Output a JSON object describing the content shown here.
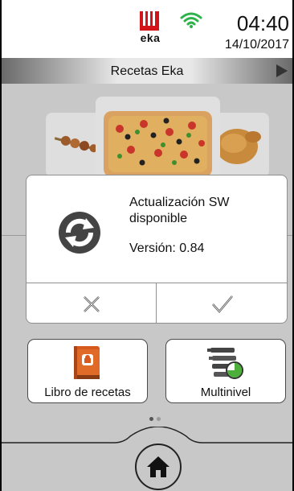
{
  "status": {
    "brand_logo_text": "eka",
    "time": "04:40",
    "date": "14/10/2017",
    "wifi_icon": "wifi-icon",
    "wifi_color": "#2db34a"
  },
  "titlebar": {
    "title": "Recetas Eka",
    "next_icon": "triangle-right-icon"
  },
  "carousel": {
    "items": [
      "skewers-image",
      "pizza-image",
      "roast-chicken-image"
    ]
  },
  "dialog": {
    "title": "Actualización SW disponible",
    "version": "Versión: 0.84",
    "icon": "sync-icon",
    "cancel_icon": "close-icon",
    "accept_icon": "checkmark-icon"
  },
  "buttons": {
    "recipe_book": {
      "label": "Libro de recetas",
      "icon": "recipe-book-icon",
      "color": "#d65a1e"
    },
    "multilevel": {
      "label": "Multinivel",
      "icon": "multilevel-trays-icon",
      "accent": "#4caf3a"
    }
  },
  "pagination": {
    "pages": 2,
    "current": 1
  },
  "nav": {
    "home_icon": "home-icon"
  },
  "colors": {
    "brand_red": "#d4141b",
    "overlay": "#c8c8c8"
  }
}
